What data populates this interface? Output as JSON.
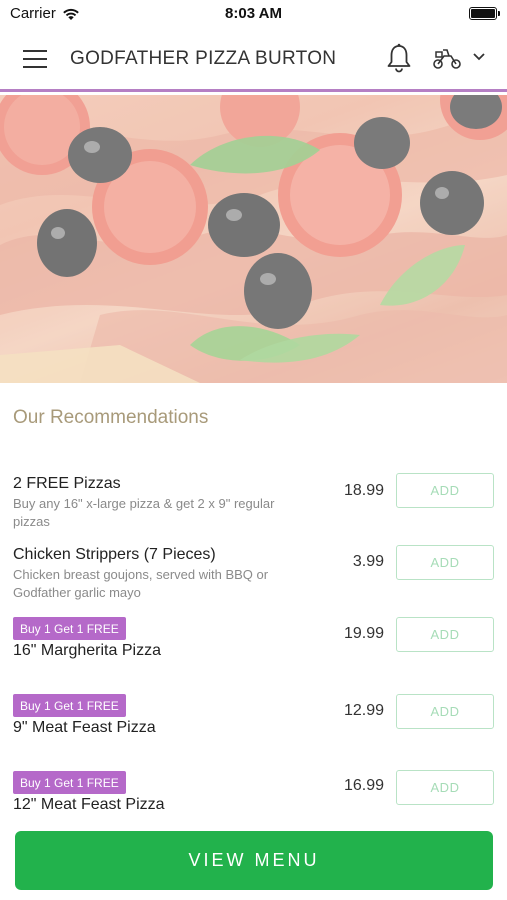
{
  "status_bar": {
    "carrier": "Carrier",
    "time": "8:03 AM"
  },
  "header": {
    "title": "GODFATHER PIZZA BURTON"
  },
  "icons": {
    "menu": "hamburger-icon",
    "bell": "bell-icon",
    "scooter": "scooter-icon",
    "chevron": "chevron-down-icon",
    "wifi": "wifi-icon",
    "battery": "battery-icon"
  },
  "colors": {
    "accent_purple": "#b57fc4",
    "badge_purple": "#b569c9",
    "button_green": "#22b24c",
    "add_green": "#a6dcb7",
    "section_title": "#a89a7a"
  },
  "recommendations": {
    "title": "Our Recommendations",
    "items": [
      {
        "name": "2 FREE Pizzas",
        "description": "Buy any 16\" x-large pizza & get 2 x 9\" regular pizzas",
        "price": "18.99",
        "add_label": "ADD"
      },
      {
        "name": "Chicken Strippers (7 Pieces)",
        "description": "Chicken breast goujons, served with BBQ or Godfather garlic mayo",
        "price": "3.99",
        "add_label": "ADD"
      },
      {
        "badge": "Buy 1 Get 1 FREE",
        "name": "16\" Margherita Pizza",
        "price": "19.99",
        "add_label": "ADD"
      },
      {
        "badge": "Buy 1 Get 1 FREE",
        "name": "9\" Meat Feast Pizza",
        "price": "12.99",
        "add_label": "ADD"
      },
      {
        "badge": "Buy 1 Get 1 FREE",
        "name": "12\" Meat Feast Pizza",
        "price": "16.99",
        "add_label": "ADD"
      }
    ]
  },
  "view_menu_label": "VIEW MENU"
}
